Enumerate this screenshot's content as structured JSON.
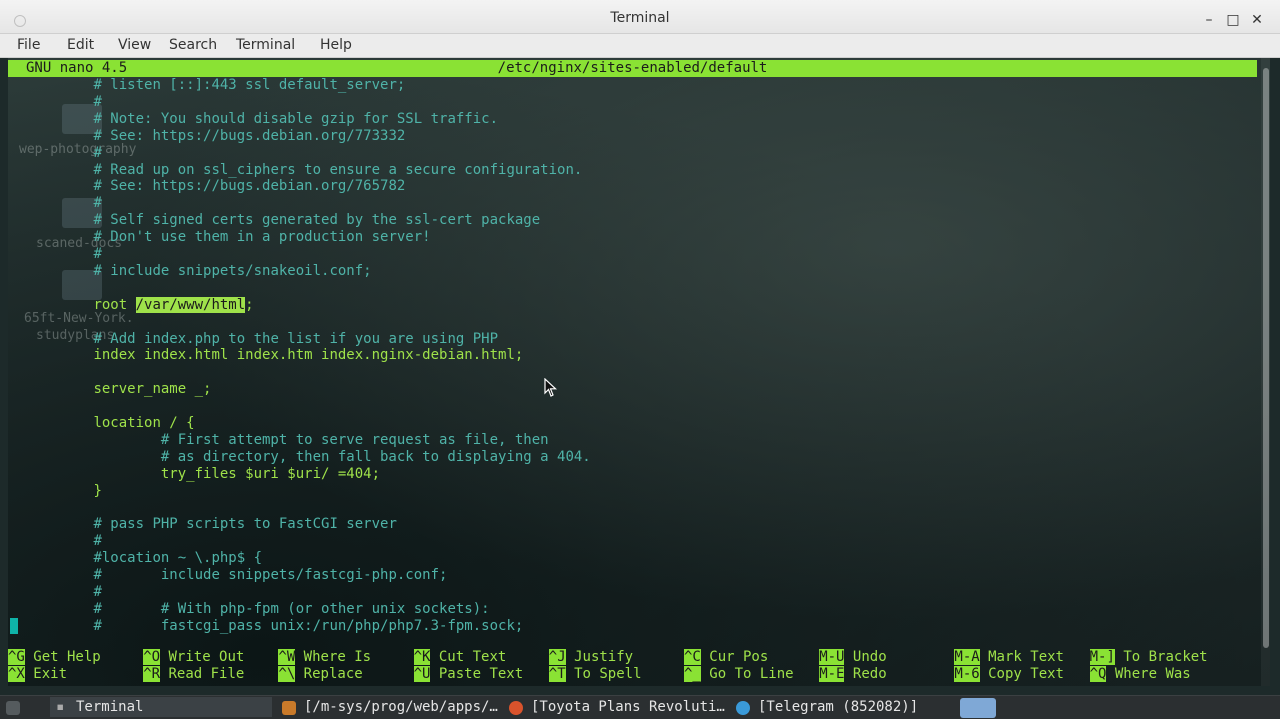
{
  "window": {
    "title": "Terminal",
    "controls": {
      "minimize": "–",
      "maximize": "□",
      "close": "✕"
    }
  },
  "menu": [
    "File",
    "Edit",
    "View",
    "Search",
    "Terminal",
    "Help"
  ],
  "nano": {
    "version": "GNU nano 4.5",
    "filename": "/etc/nginx/sites-enabled/default"
  },
  "desktop_ghosts": [
    "wep-photography",
    "scaned-docs",
    "65ft-New-York.",
    "studyplans"
  ],
  "lines": [
    {
      "indent": "        ",
      "text": "# listen [::]:443 ssl default_server;",
      "kind": "comment"
    },
    {
      "indent": "        ",
      "text": "#",
      "kind": "comment"
    },
    {
      "indent": "        ",
      "text": "# Note: You should disable gzip for SSL traffic.",
      "kind": "comment"
    },
    {
      "indent": "        ",
      "text": "# See: https://bugs.debian.org/773332",
      "kind": "comment"
    },
    {
      "indent": "        ",
      "text": "#",
      "kind": "comment"
    },
    {
      "indent": "        ",
      "text": "# Read up on ssl_ciphers to ensure a secure configuration.",
      "kind": "comment"
    },
    {
      "indent": "        ",
      "text": "# See: https://bugs.debian.org/765782",
      "kind": "comment"
    },
    {
      "indent": "        ",
      "text": "#",
      "kind": "comment"
    },
    {
      "indent": "        ",
      "text": "# Self signed certs generated by the ssl-cert package",
      "kind": "comment"
    },
    {
      "indent": "        ",
      "text": "# Don't use them in a production server!",
      "kind": "comment"
    },
    {
      "indent": "        ",
      "text": "#",
      "kind": "comment"
    },
    {
      "indent": "        ",
      "text": "# include snippets/snakeoil.conf;",
      "kind": "comment"
    },
    {
      "indent": "",
      "text": "",
      "kind": "blank"
    },
    {
      "indent": "        ",
      "text": "root ",
      "kind": "code",
      "hl": "/var/www/html",
      "after": ";"
    },
    {
      "indent": "",
      "text": "",
      "kind": "blank"
    },
    {
      "indent": "        ",
      "text": "# Add index.php to the list if you are using PHP",
      "kind": "comment"
    },
    {
      "indent": "        ",
      "text": "index index.html index.htm index.nginx-debian.html;",
      "kind": "code"
    },
    {
      "indent": "",
      "text": "",
      "kind": "blank"
    },
    {
      "indent": "        ",
      "text": "server_name _;",
      "kind": "code"
    },
    {
      "indent": "",
      "text": "",
      "kind": "blank"
    },
    {
      "indent": "        ",
      "text": "location / {",
      "kind": "code"
    },
    {
      "indent": "                ",
      "text": "# First attempt to serve request as file, then",
      "kind": "comment"
    },
    {
      "indent": "                ",
      "text": "# as directory, then fall back to displaying a 404.",
      "kind": "comment"
    },
    {
      "indent": "                ",
      "text": "try_files $uri $uri/ =404;",
      "kind": "code"
    },
    {
      "indent": "        ",
      "text": "}",
      "kind": "code"
    },
    {
      "indent": "",
      "text": "",
      "kind": "blank"
    },
    {
      "indent": "        ",
      "text": "# pass PHP scripts to FastCGI server",
      "kind": "comment"
    },
    {
      "indent": "        ",
      "text": "#",
      "kind": "comment"
    },
    {
      "indent": "        ",
      "text": "#location ~ \\.php$ {",
      "kind": "comment"
    },
    {
      "indent": "        ",
      "text": "#       include snippets/fastcgi-php.conf;",
      "kind": "comment"
    },
    {
      "indent": "        ",
      "text": "#",
      "kind": "comment"
    },
    {
      "indent": "        ",
      "text": "#       # With php-fpm (or other unix sockets):",
      "kind": "comment"
    },
    {
      "indent": "        ",
      "text": "#       fastcgi_pass unix:/run/php/php7.3-fpm.sock;",
      "kind": "comment"
    }
  ],
  "help": [
    {
      "key": "^G",
      "label": " Get Help",
      "key2": "^X",
      "label2": " Exit"
    },
    {
      "key": "^O",
      "label": " Write Out",
      "key2": "^R",
      "label2": " Read File"
    },
    {
      "key": "^W",
      "label": " Where Is",
      "key2": "^\\",
      "label2": " Replace"
    },
    {
      "key": "^K",
      "label": " Cut Text",
      "key2": "^U",
      "label2": " Paste Text"
    },
    {
      "key": "^J",
      "label": " Justify",
      "key2": "^T",
      "label2": " To Spell"
    },
    {
      "key": "^C",
      "label": " Cur Pos",
      "key2": "^_",
      "label2": " Go To Line"
    },
    {
      "key": "M-U",
      "label": " Undo",
      "key2": "M-E",
      "label2": " Redo"
    },
    {
      "key": "M-A",
      "label": " Mark Text",
      "key2": "M-6",
      "label2": " Copy Text"
    },
    {
      "key": "M-]",
      "label": " To Bracket",
      "key2": "^Q",
      "label2": " Where Was"
    }
  ],
  "taskbar": {
    "tasks": [
      "Terminal",
      "[/m-sys/prog/web/apps/…",
      "[Toyota Plans Revoluti…",
      "[Telegram (852082)]"
    ]
  },
  "colors": {
    "nano_green": "#8ae234",
    "code_green": "#9fe24a",
    "comment_teal": "#4fb3a8"
  }
}
